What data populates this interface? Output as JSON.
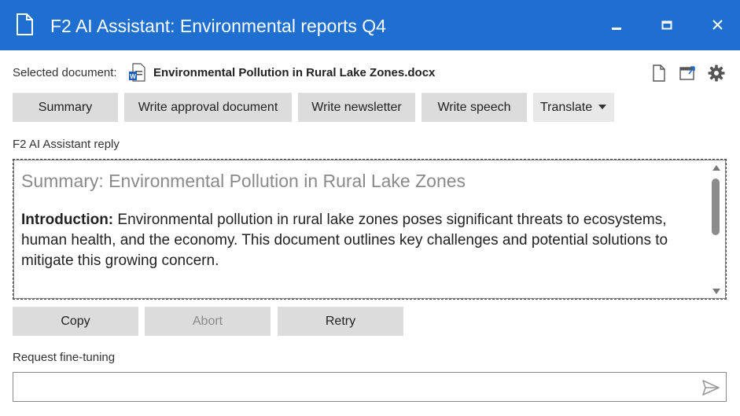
{
  "window": {
    "title": "F2 AI Assistant: Environmental reports Q4",
    "accent_color": "#1e6fd0",
    "icons": [
      "document-icon",
      "minimize-icon",
      "maximize-icon",
      "close-icon"
    ]
  },
  "selected_document": {
    "label": "Selected document:",
    "file_icon": "word-doc-icon",
    "filename": "Environmental Pollution in Rural Lake Zones.docx",
    "toolbar_icons": [
      "new-document-icon",
      "open-window-icon",
      "settings-gear-icon"
    ]
  },
  "actions": {
    "summary": "Summary",
    "approval": "Write approval document",
    "newsletter": "Write newsletter",
    "speech": "Write speech",
    "translate": "Translate"
  },
  "reply": {
    "label": "F2 AI Assistant reply",
    "title": "Summary: Environmental Pollution in Rural Lake Zones",
    "intro_heading": "Introduction:",
    "intro_text": " Environmental pollution in rural lake zones poses significant threats to ecosystems, human health, and the economy. This document outlines key challenges and potential solutions to mitigate this growing concern."
  },
  "buttons": {
    "copy": "Copy",
    "abort": "Abort",
    "retry": "Retry"
  },
  "fine_tuning": {
    "label": "Request fine-tuning",
    "value": "",
    "send_icon": "send-icon"
  }
}
